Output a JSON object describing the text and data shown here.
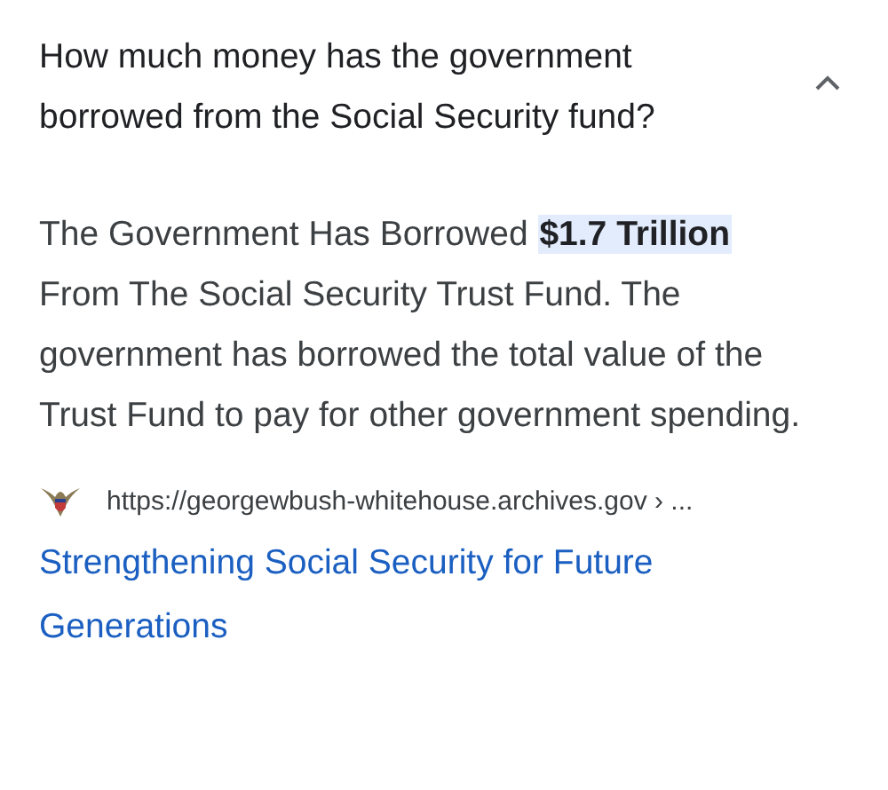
{
  "question": {
    "text": "How much money has the government borrowed from the Social Security fund?",
    "expanded": true
  },
  "answer": {
    "text": "The Government Has Borrowed **$1.7 Trillion** From The Social Security Trust Fund. The government has borrowed the total value of the Trust Fund to pay for other government spending."
  },
  "source": {
    "url": "https://georgewbush-whitehouse.archives.gov › ...",
    "title": "Strengthening Social Security for Future Generations"
  }
}
